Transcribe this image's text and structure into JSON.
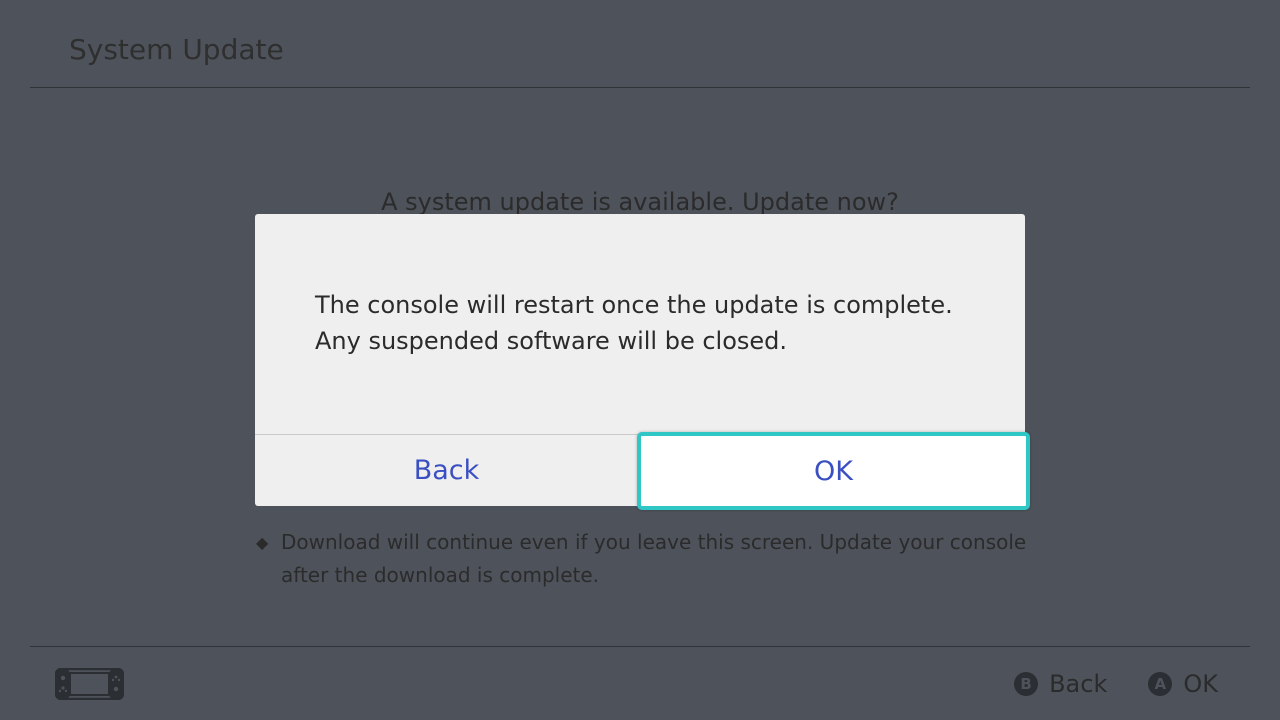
{
  "header": {
    "title": "System Update"
  },
  "main": {
    "question": "A system update is available. Update now?",
    "note_bullet": "◆",
    "note": "Download will continue even if you leave this screen. Update your console after the download is complete."
  },
  "dialog": {
    "message_line1": "The console will restart once the update is complete.",
    "message_line2": "Any suspended software will be closed.",
    "back_label": "Back",
    "ok_label": "OK",
    "accent_color": "#2fc6c6",
    "button_text_color": "#3a4fc2"
  },
  "footer": {
    "console_icon": "handheld-console-icon",
    "hints": [
      {
        "button": "B",
        "label": "Back"
      },
      {
        "button": "A",
        "label": "OK"
      }
    ]
  }
}
